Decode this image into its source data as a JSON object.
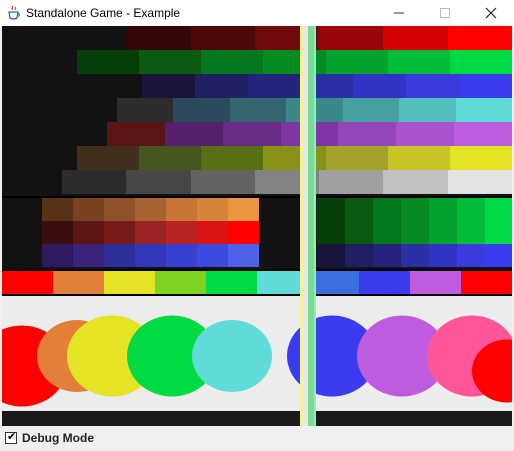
{
  "window": {
    "title": "Standalone Game - Example",
    "controls": [
      "minimize",
      "maximize",
      "close"
    ],
    "icons": {
      "app": "java-cup-icon"
    }
  },
  "game": {
    "palettes": [
      [
        "#121212",
        "#121212",
        "#350607",
        "#4e0809",
        "#6e0a0c",
        "#9b0608",
        "#d60004",
        "#ff0000"
      ],
      [
        "#121212",
        "#053f08",
        "#0a5b0f",
        "#04761b",
        "#048c23",
        "#03a12e",
        "#02bd3a",
        "#00da42"
      ],
      [
        "#121212",
        "#19153e",
        "#1f1f62",
        "#25247c",
        "#2c2fa4",
        "#3232c4",
        "#3a3add",
        "#3b3bef"
      ],
      [
        "#121212",
        "#2d2d2d",
        "#2b4b5c",
        "#33666e",
        "#3c8787",
        "#46a0a0",
        "#52bebe",
        "#5fdcd8"
      ],
      [
        "#121212",
        "#5a1616",
        "#57206d",
        "#6a2b86",
        "#7e36a2",
        "#9445b9",
        "#aa52cd",
        "#bf5bdf"
      ],
      [
        "#121212",
        "#40301d",
        "#45551e",
        "#577014",
        "#889118",
        "#a3a22a",
        "#c7c52a",
        "#e5e326"
      ],
      [
        "#121212",
        "#2c2c2c",
        "#474747",
        "#636363",
        "#838383",
        "#a0a0a0",
        "#c1c1c1",
        "#e3e3e3"
      ],
      [
        "#121212",
        "#5a3218",
        "#7a4223",
        "#8f522d",
        "#a86332",
        "#c77436",
        "#d6843c",
        "#ea9540"
      ],
      [
        "#121212",
        "#3b0d0d",
        "#5c1414",
        "#7a1b1b",
        "#9a2222",
        "#b82424",
        "#d91515",
        "#ff0000"
      ],
      [
        "#121212",
        "#2e1a5e",
        "#3b237b",
        "#2d2f9a",
        "#3236b8",
        "#3840d2",
        "#3c4ae0",
        "#4c62e8"
      ]
    ],
    "rainbow": [
      "#ff0000",
      "#e2803a",
      "#e5e326",
      "#7ed321",
      "#00da42",
      "#5fdcd8",
      "#3b6fdf",
      "#3b3bef",
      "#bf5bdf",
      "#ff0000"
    ],
    "debug_stripe": [
      "#f3f29b",
      "#e6e6e6",
      "#7bdb93",
      "#8af0c3"
    ]
  },
  "footer": {
    "debug_label": "Debug Mode",
    "debug_checked": true,
    "icons": {
      "checkbox": "check-icon"
    }
  }
}
